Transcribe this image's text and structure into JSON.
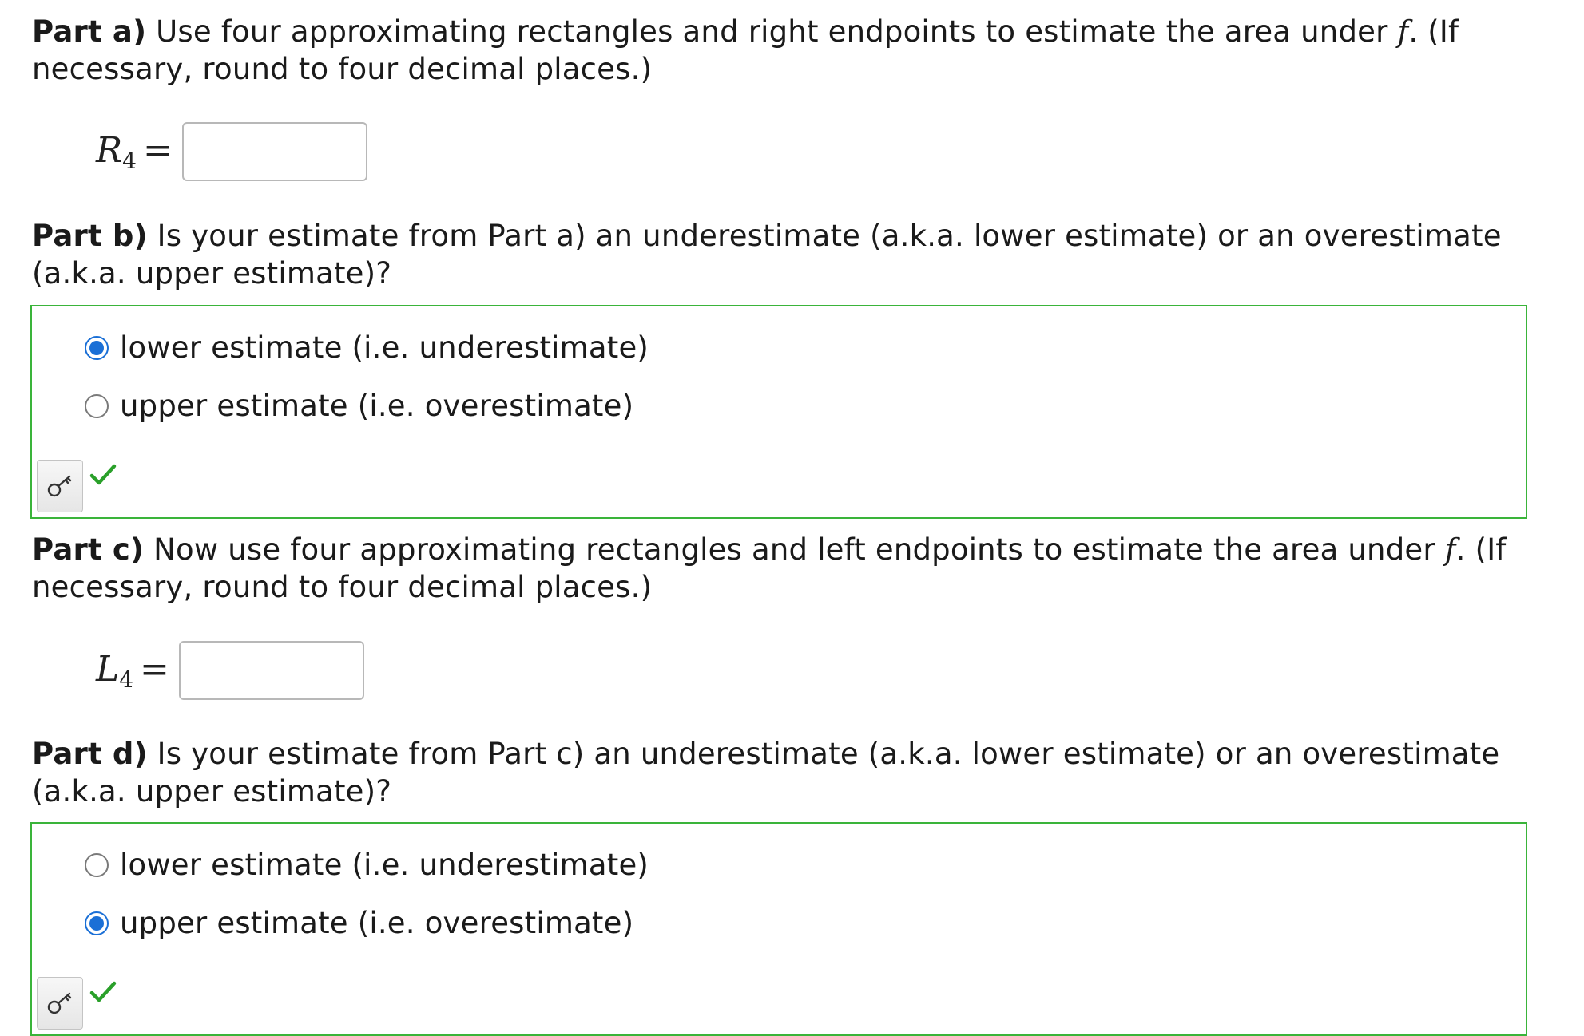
{
  "part_a": {
    "label": "Part a)",
    "text_before_f": " Use four approximating rectangles and right endpoints to estimate the area under ",
    "f": "f",
    "text_after_f": ". (If necessary, round to four decimal places.)",
    "symbol": "R",
    "subscript": "4",
    "equals": "=",
    "input_value": "",
    "input_placeholder": ""
  },
  "part_b": {
    "label": "Part b)",
    "text": " Is your estimate from Part a) an underestimate (a.k.a. lower estimate) or an overestimate (a.k.a. upper estimate)?",
    "options": [
      {
        "label": "lower estimate (i.e. underestimate)",
        "selected": true
      },
      {
        "label": "upper estimate (i.e. overestimate)",
        "selected": false
      }
    ],
    "status": "correct"
  },
  "part_c": {
    "label": "Part c)",
    "text_before_f": " Now use four approximating rectangles and left endpoints to estimate the area under ",
    "f": "f",
    "text_after_f": ". (If necessary, round to four decimal places.)",
    "symbol": "L",
    "subscript": "4",
    "equals": "=",
    "input_value": "",
    "input_placeholder": ""
  },
  "part_d": {
    "label": "Part d)",
    "text": " Is your estimate from Part c) an underestimate (a.k.a. lower estimate) or an overestimate (a.k.a. upper estimate)?",
    "options": [
      {
        "label": "lower estimate (i.e. underestimate)",
        "selected": false
      },
      {
        "label": "upper estimate (i.e. overestimate)",
        "selected": true
      }
    ],
    "status": "correct"
  },
  "icons": {
    "answer_key": "key-icon",
    "correct": "checkmark-icon"
  },
  "colors": {
    "box_border": "#3ab43a",
    "checkmark": "#2aa02a",
    "radio_selected": "#1a6fd6"
  }
}
